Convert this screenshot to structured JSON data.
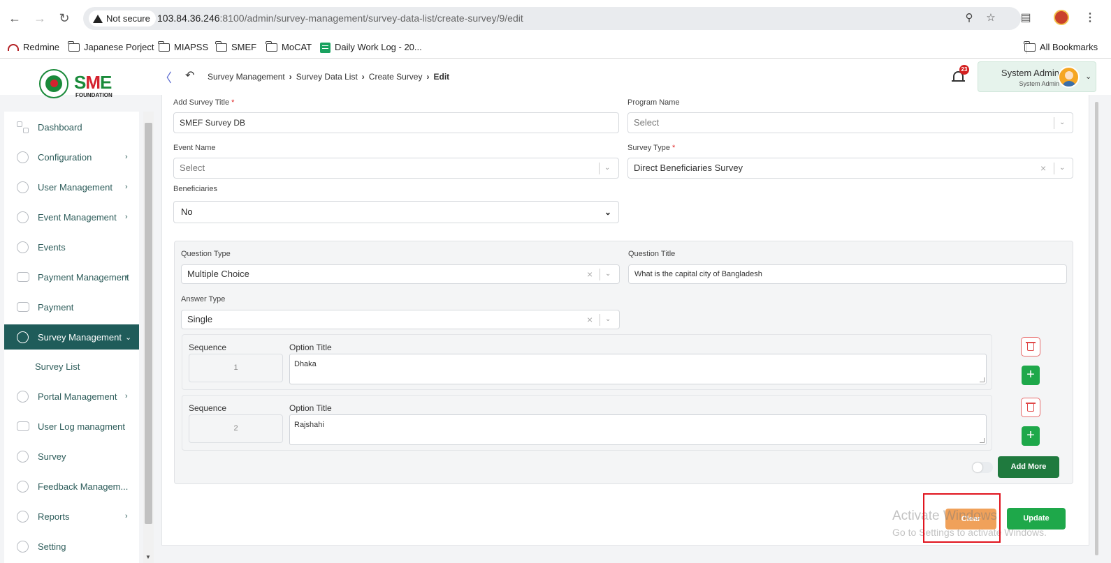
{
  "browser": {
    "security_label": "Not secure",
    "url_host": "103.84.36.246",
    "url_rest": ":8100/admin/survey-management/survey-data-list/create-survey/9/edit",
    "bookmarks": [
      "Redmine",
      "Japanese Porject",
      "MIAPSS",
      "SMEF",
      "MoCAT",
      "Daily Work Log - 20...",
      "All Bookmarks"
    ]
  },
  "app": {
    "logo_text_a": "S",
    "logo_text_b": "M",
    "logo_text_c": "E",
    "logo_sub": "FOUNDATION",
    "breadcrumb": [
      "Survey Management",
      "Survey Data List",
      "Create Survey",
      "Edit"
    ],
    "notification_count": "23",
    "user_name": "System Admin",
    "user_role": "System Admin"
  },
  "sidebar": {
    "items": [
      {
        "label": "Dashboard"
      },
      {
        "label": "Configuration"
      },
      {
        "label": "User Management"
      },
      {
        "label": "Event Management"
      },
      {
        "label": "Events"
      },
      {
        "label": "Payment Management"
      },
      {
        "label": "Payment"
      },
      {
        "label": "Survey Management"
      },
      {
        "label": "Portal Management"
      },
      {
        "label": "User Log managment"
      },
      {
        "label": "Survey"
      },
      {
        "label": "Feedback Managem..."
      },
      {
        "label": "Reports"
      },
      {
        "label": "Setting"
      }
    ],
    "sub_items": [
      {
        "label": "Survey List"
      }
    ]
  },
  "form": {
    "survey_title_label": "Add Survey Title",
    "survey_title_value": "SMEF Survey DB",
    "program_name_label": "Program Name",
    "program_name_placeholder": "Select",
    "event_name_label": "Event Name",
    "event_name_placeholder": "Select",
    "survey_type_label": "Survey Type",
    "survey_type_value": "Direct Beneficiaries Survey",
    "beneficiaries_label": "Beneficiaries",
    "beneficiaries_value": "No",
    "question_type_label": "Question Type",
    "question_type_value": "Multiple Choice",
    "question_title_label": "Question Title",
    "question_title_value": "What is the capital city of Bangladesh",
    "answer_type_label": "Answer Type",
    "answer_type_value": "Single",
    "sequence_label": "Sequence",
    "option_title_label": "Option Title",
    "options": [
      {
        "sequence": "1",
        "title": "Dhaka"
      },
      {
        "sequence": "2",
        "title": "Rajshahi"
      }
    ],
    "add_more_label": "Add More",
    "clear_label": "Clear",
    "update_label": "Update",
    "required_mark": "*"
  },
  "watermark": {
    "line1": "Activate Windows",
    "line2": "Go to Settings to activate Windows."
  },
  "colors": {
    "accent": "#1f5c5a",
    "success": "#1ea84a",
    "warning": "#f0a15a",
    "danger": "#e04848"
  }
}
